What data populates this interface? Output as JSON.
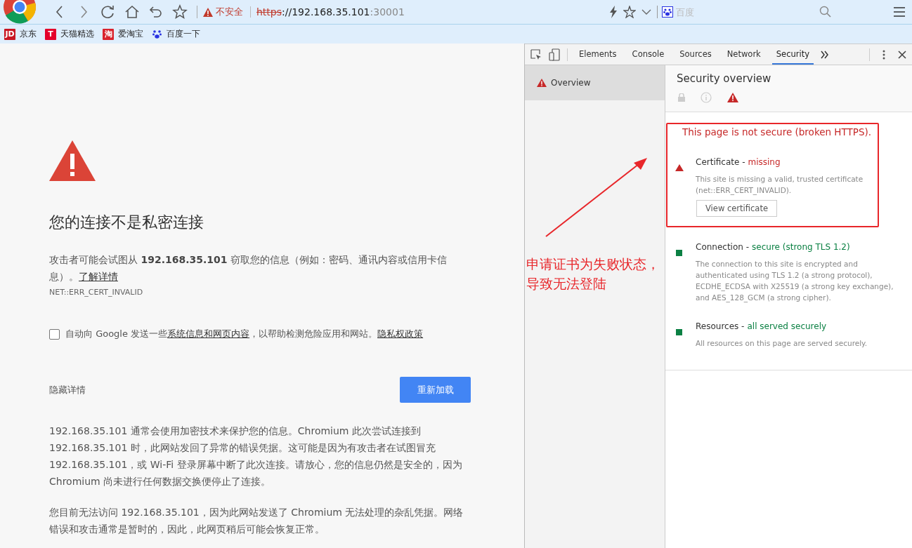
{
  "browser": {
    "security_label": "不安全",
    "url": {
      "scheme": "https",
      "host": "://192.168.35.101",
      "port": ":30001"
    },
    "search": {
      "placeholder": "百度"
    }
  },
  "bookmarks": [
    {
      "badge": "JD",
      "label": "京东"
    },
    {
      "badge": "T",
      "label": "天猫精选"
    },
    {
      "badge": "淘",
      "label": "爱淘宝"
    },
    {
      "label": "百度一下"
    }
  ],
  "error_page": {
    "title": "您的连接不是私密连接",
    "message": "攻击者可能会试图从 **192.168.35.101** 窃取您的信息（例如：密码、通讯内容或信用卡信息）。",
    "learn_more": "了解详情",
    "error_code": "NET::ERR_CERT_INVALID",
    "opt_in": {
      "checked": false,
      "before": "自动向 Google 发送一些",
      "link": "系统信息和网页内容",
      "after": "，以帮助检测危险应用和网站。",
      "privacy": "隐私权政策"
    },
    "hide_details": "隐藏详情",
    "reload_button": "重新加载",
    "details": [
      "192.168.35.101 通常会使用加密技术来保护您的信息。Chromium 此次尝试连接到 192.168.35.101 时，此网站发回了异常的错误凭据。这可能是因为有攻击者在试图冒充 192.168.35.101，或 Wi-Fi 登录屏幕中断了此次连接。请放心，您的信息仍然是安全的，因为 Chromium 尚未进行任何数据交换便停止了连接。",
      "您目前无法访问 192.168.35.101，因为此网站发送了 Chromium 无法处理的杂乱凭据。网络错误和攻击通常是暂时的，因此，此网页稍后可能会恢复正常。"
    ]
  },
  "devtools": {
    "tabs": [
      {
        "label": "Elements",
        "selected": false
      },
      {
        "label": "Console",
        "selected": false
      },
      {
        "label": "Sources",
        "selected": false
      },
      {
        "label": "Network",
        "selected": false
      },
      {
        "label": "Security",
        "selected": true
      }
    ],
    "sidebar": [
      {
        "label": "Overview",
        "selected": true
      }
    ],
    "title": "Security overview",
    "summary": "This page is not secure (broken HTTPS).",
    "sections": [
      {
        "kind": "insecure",
        "title": "Certificate -",
        "value": "missing",
        "description": "This site is missing a valid, trusted certificate (net::ERR_CERT_INVALID).",
        "button": "View certificate"
      },
      {
        "kind": "secure",
        "title": "Connection -",
        "value": "secure (strong TLS 1.2)",
        "description": "The connection to this site is encrypted and authenticated using TLS 1.2 (a strong protocol), ECDHE_ECDSA with X25519 (a strong key exchange), and AES_128_GCM (a strong cipher)."
      },
      {
        "kind": "secure",
        "title": "Resources -",
        "value": "all served securely",
        "description": "All resources on this page are served securely."
      }
    ]
  },
  "annotation": {
    "text": "申请证书为失败状态，导致无法登陆"
  }
}
